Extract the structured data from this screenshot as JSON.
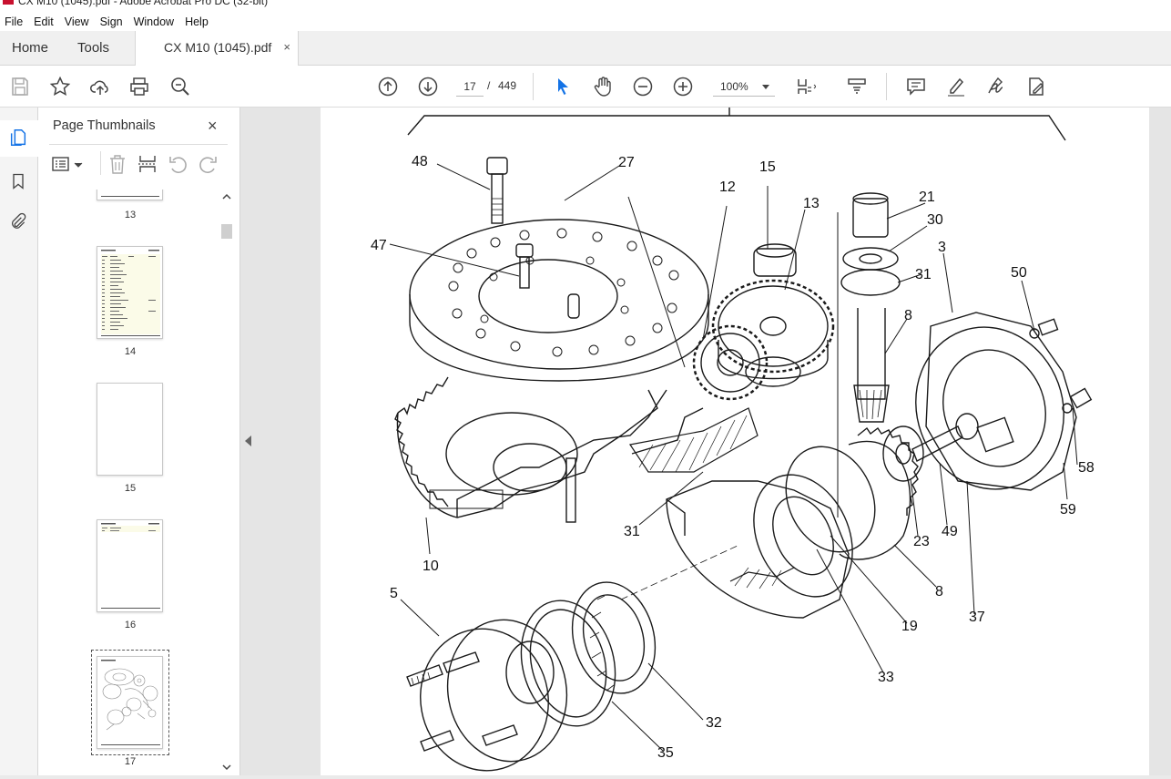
{
  "window": {
    "title": "CX M10 (1045).pdf - Adobe Acrobat Pro DC (32-bit)"
  },
  "menu": [
    "File",
    "Edit",
    "View",
    "Sign",
    "Window",
    "Help"
  ],
  "tabs": {
    "home": "Home",
    "tools": "Tools",
    "document": "CX M10 (1045).pdf",
    "close_glyph": "×"
  },
  "toolbar": {
    "current_page": "17",
    "page_separator": "/",
    "total_pages": "449",
    "zoom": "100%",
    "icons": [
      "save-icon",
      "star-icon",
      "upload-icon",
      "print-icon",
      "find-zoom-icon",
      "prev-page-icon",
      "next-page-icon",
      "select-arrow-icon",
      "hand-icon",
      "zoom-out-icon",
      "zoom-in-icon",
      "fit-page-icon",
      "scroll-mode-icon",
      "comment-icon",
      "highlight-icon",
      "sign-icon",
      "edit-pdf-icon"
    ]
  },
  "thumbnails": {
    "title": "Page Thumbnails",
    "close_glyph": "×",
    "pages": [
      {
        "label": "13"
      },
      {
        "label": "14"
      },
      {
        "label": "15"
      },
      {
        "label": "16"
      },
      {
        "label": "17",
        "selected": true
      }
    ]
  },
  "drawing": {
    "callouts": [
      "48",
      "27",
      "15",
      "12",
      "13",
      "21",
      "30",
      "31",
      "3",
      "50",
      "8",
      "47",
      "58",
      "59",
      "49",
      "23",
      "31",
      "10",
      "5",
      "37",
      "8",
      "19",
      "33",
      "32",
      "35"
    ]
  },
  "colors": {
    "accent_blue": "#1473e6",
    "panel_bg": "#f4f4f4",
    "doc_bg": "#e5e5e5"
  }
}
